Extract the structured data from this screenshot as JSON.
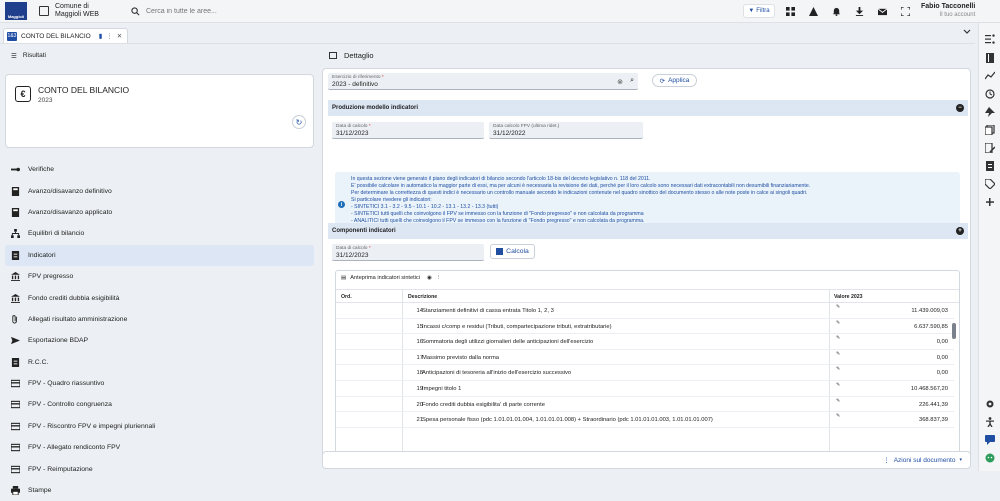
{
  "topbar": {
    "logo_text": "Maggioli",
    "muni_line1": "Comune di",
    "muni_line2": "Maggioli WEB",
    "search_placeholder": "Cerca in tutte le aree...",
    "filtra_label": "Filtra",
    "user_name": "Fabio Tacconelli",
    "user_role": "Il tuo account"
  },
  "tab": {
    "icon_text": "1&3",
    "label": "CONTO DEL BILANCIO"
  },
  "left": {
    "header": "Risultati",
    "card_title": "CONTO DEL BILANCIO",
    "card_year": "2023",
    "menu": [
      {
        "label": "Verifiche",
        "icon": "wrench-icon"
      },
      {
        "label": "Avanzo/disavanzo definitivo",
        "icon": "calculator-icon"
      },
      {
        "label": "Avanzo/disavanzo applicato",
        "icon": "calculator-icon"
      },
      {
        "label": "Equilibri di bilancio",
        "icon": "sitemap-icon"
      },
      {
        "label": "Indicatori",
        "icon": "document-icon"
      },
      {
        "label": "FPV pregresso",
        "icon": "bank-icon"
      },
      {
        "label": "Fondo crediti dubbia esigibilità",
        "icon": "bank-icon"
      },
      {
        "label": "Allegati risultato amministrazione",
        "icon": "paperclip-icon"
      },
      {
        "label": "Esportazione BDAP",
        "icon": "send-icon"
      },
      {
        "label": "R.C.C.",
        "icon": "document-icon"
      },
      {
        "label": "FPV - Quadro riassuntivo",
        "icon": "card-icon"
      },
      {
        "label": "FPV - Controllo congruenza",
        "icon": "card-icon"
      },
      {
        "label": "FPV - Riscontro FPV e impegni pluriennali",
        "icon": "card-icon"
      },
      {
        "label": "FPV - Allegato rendiconto FPV",
        "icon": "card-icon"
      },
      {
        "label": "FPV - Reimputazione",
        "icon": "card-icon"
      },
      {
        "label": "Stampe",
        "icon": "printer-icon"
      }
    ],
    "active_index": 4
  },
  "main": {
    "header": "Dettaglio",
    "esercizio_label": "Esercizio di riferimento",
    "esercizio_value": "2023 - definitivo",
    "applica_label": "Applica",
    "section1": "Produzione modello indicatori",
    "data_calcolo_label": "Data di calcolo",
    "data_calcolo_value": "31/12/2023",
    "data_fpv_label": "Data calcolo FPV (ultima ridet.)",
    "data_fpv_value": "31/12/2022",
    "info_lines": [
      "In questa sezione viene generato il piano degli indicatori di bilancio secondo l'articolo 18-bis del decreto legislativo n. 118 del 2011.",
      "E' possibile calcolare in automatico la maggior parte di essi, ma per alcuni è necessaria la revisione dei dati, perché per il loro calcolo sono necessari dati extracontabili non desumibili finanziariamente.",
      "Per determinare la correttezza di questi indici è necessario un controllo manuale secondo le indicazioni contenute nel quadro sinottico del documento stesso o alle note poste in calce ai singoli quadri.",
      "Si particolare rivedere gli indicatori:",
      "- SINTETICI 3.1 - 3.2 - 9.5 - 10.1 - 10.2 - 13.1 - 13.2 - 13.3 (tutti)",
      "- SINTETICI tutti quelli che coinvolgono il FPV se immesso con la funzione di \"Fondo pregresso\" e non calcolata da programma",
      "- ANALITICI tutti quelli che coinvolgono il FPV se immesso con la funzione di \"Fondo pregresso\" e non calcolata da programma."
    ],
    "section2": "Componenti indicatori",
    "data_calcolo2_label": "Data di calcolo",
    "data_calcolo2_value": "31/12/2023",
    "calcola_label": "Calcola",
    "table_title": "Anteprima indicatori sintetici",
    "col_ord": "Ord.",
    "col_desc": "Descrizione",
    "col_val": "Valore 2023",
    "rows": [
      {
        "ord": "14",
        "desc": "Stanziamenti definitivi di cassa entrata Titolo 1, 2, 3",
        "val": "11.439.009,03"
      },
      {
        "ord": "15",
        "desc": "Incassi c/comp e residui (Tributi, compartecipazione tributi, extratributarie)",
        "val": "6.637.590,85"
      },
      {
        "ord": "16",
        "desc": "Sommatoria degli utilizzi giornalieri delle anticipazioni dell'esercizio",
        "val": "0,00"
      },
      {
        "ord": "17",
        "desc": "Massimo previsto dalla norma",
        "val": "0,00"
      },
      {
        "ord": "18",
        "desc": "Anticipazioni di tesoreria all'inizio dell'esercizio successivo",
        "val": "0,00"
      },
      {
        "ord": "19",
        "desc": "Impegni titolo 1",
        "val": "10.468.567,20"
      },
      {
        "ord": "20",
        "desc": "Fondo crediti dubbia esigibilita' di parte corrente",
        "val": "226.441,39"
      },
      {
        "ord": "21",
        "desc": "Spesa personale fisso (pdc 1.01.01.01.004, 1.01.01.01.008) + Straordinario (pdc 1.01.01.01.003, 1.01.01.01.007)",
        "val": "368.837,39"
      }
    ],
    "azioni_label": "Azioni sul documento"
  },
  "colors": {
    "accent": "#1f4ea3",
    "active": "#dce6f4",
    "section": "#dde7f3",
    "info_bg": "#eaf3f9",
    "required": "#e0242d"
  }
}
